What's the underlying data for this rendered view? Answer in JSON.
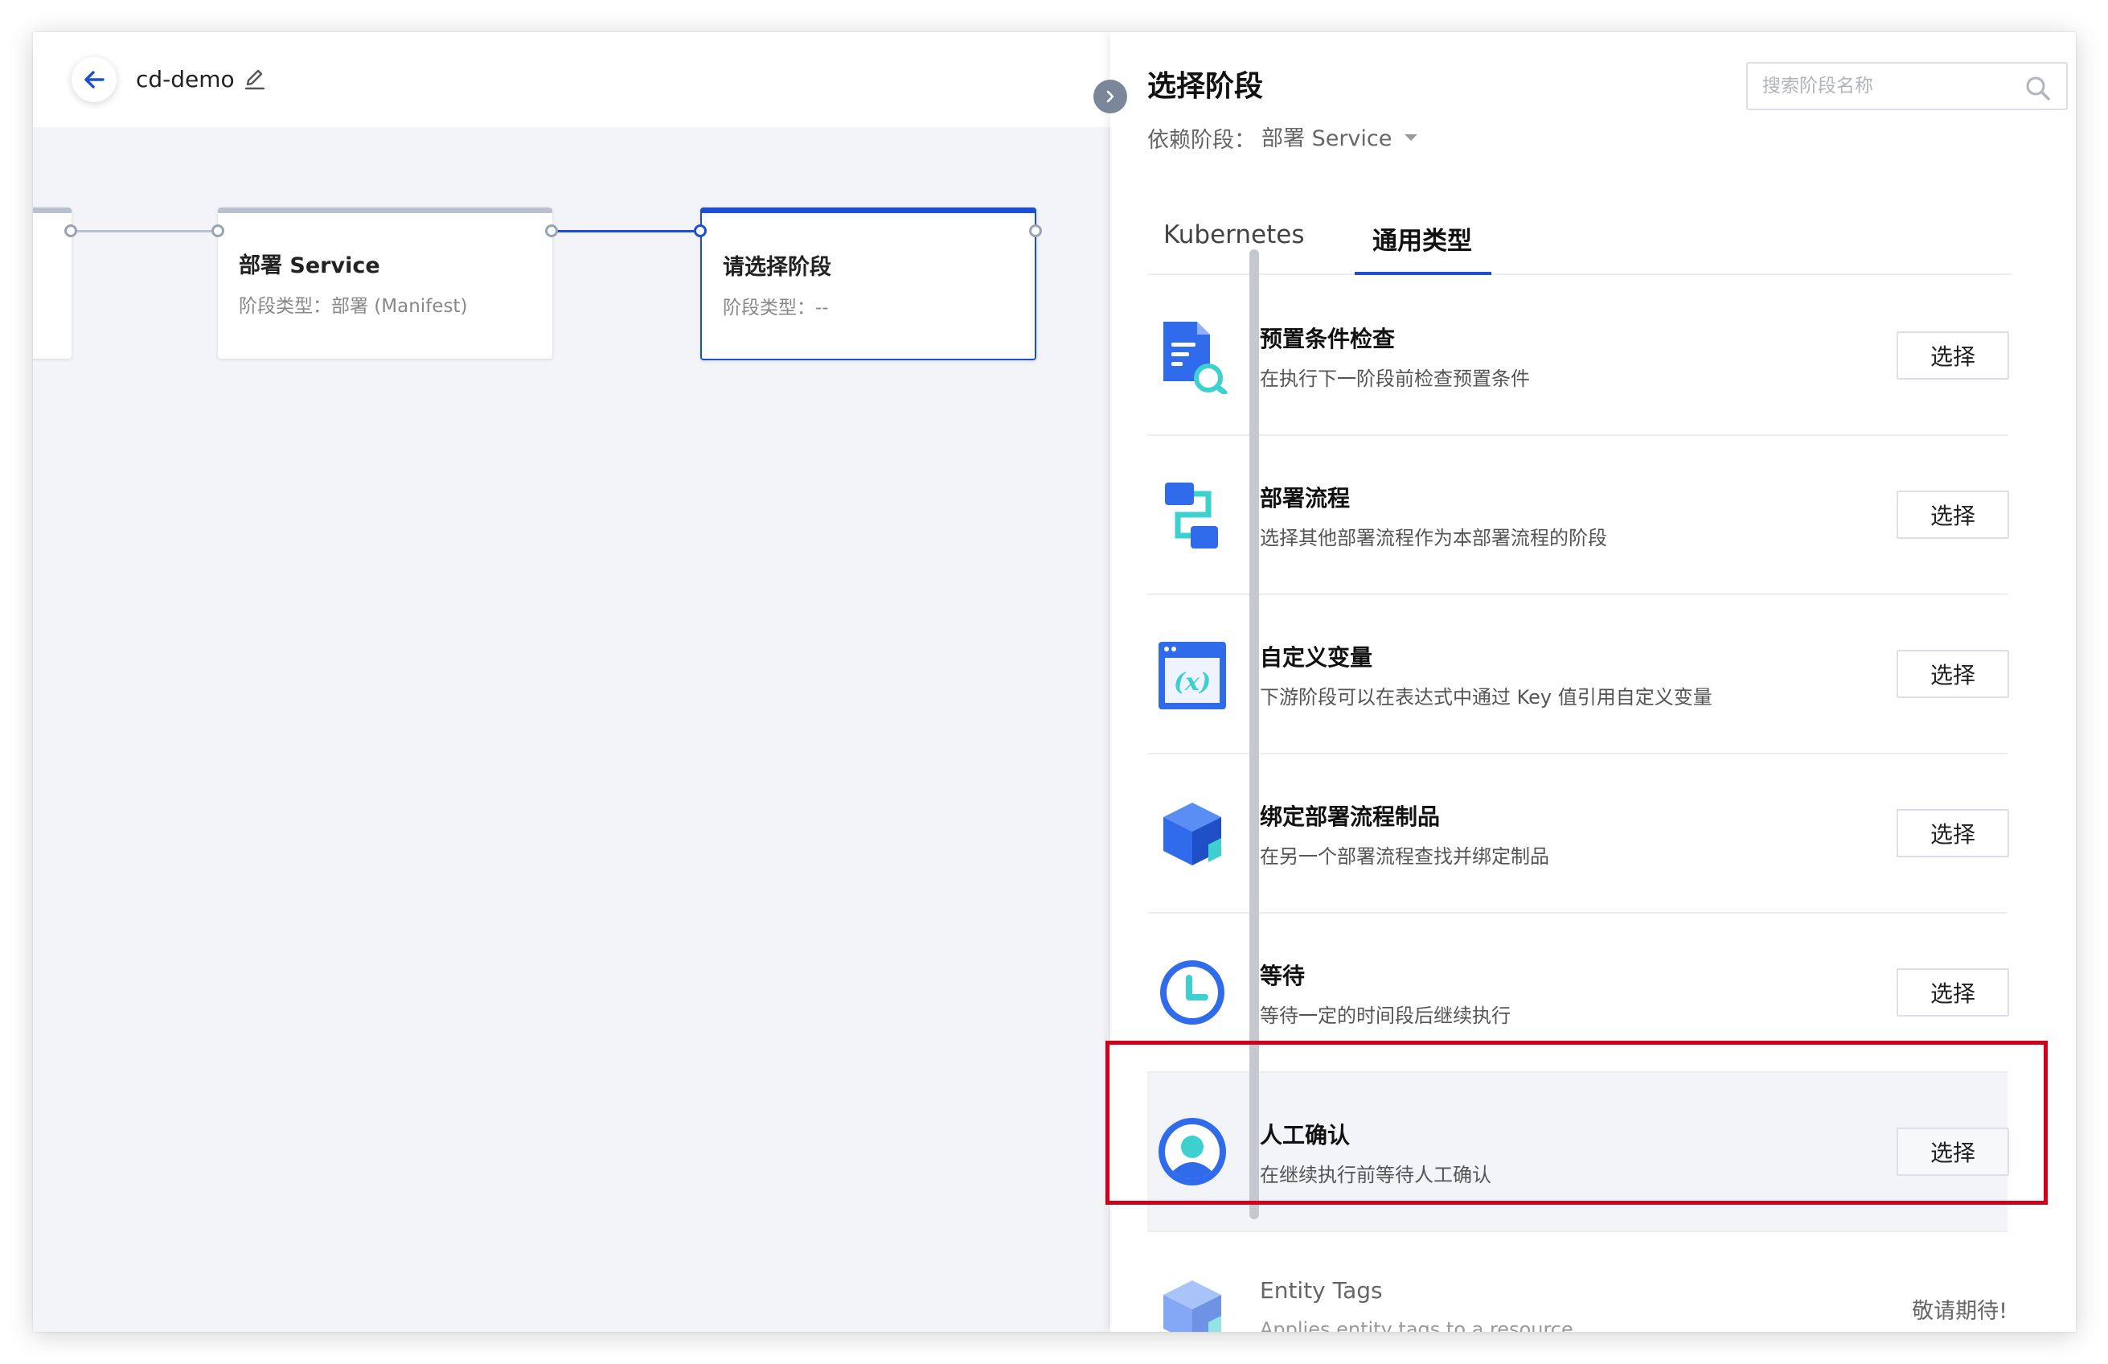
{
  "header": {
    "title": "cd-demo"
  },
  "canvas": {
    "nodes": [
      {
        "title": "部署 Service",
        "subtitle": "阶段类型：部署 (Manifest)"
      },
      {
        "title": "请选择阶段",
        "subtitle": "阶段类型：--"
      }
    ]
  },
  "panel": {
    "title": "选择阶段",
    "search_placeholder": "搜索阶段名称",
    "dependency_label": "依赖阶段：",
    "dependency_value": "部署 Service",
    "tabs": [
      {
        "label": "Kubernetes",
        "active": false
      },
      {
        "label": "通用类型",
        "active": true
      }
    ],
    "select_label": "选择",
    "items": [
      {
        "name": "预置条件检查",
        "desc": "在执行下一阶段前检查预置条件",
        "icon": "checklist-search-icon"
      },
      {
        "name": "部署流程",
        "desc": "选择其他部署流程作为本部署流程的阶段",
        "icon": "flow-icon"
      },
      {
        "name": "自定义变量",
        "desc": "下游阶段可以在表达式中通过 Key 值引用自定义变量",
        "icon": "variable-icon"
      },
      {
        "name": "绑定部署流程制品",
        "desc": "在另一个部署流程查找并绑定制品",
        "icon": "cube-icon"
      },
      {
        "name": "等待",
        "desc": "等待一定的时间段后继续执行",
        "icon": "clock-icon"
      },
      {
        "name": "人工确认",
        "desc": "在继续执行前等待人工确认",
        "icon": "user-icon",
        "highlighted": true
      },
      {
        "name": "Entity Tags",
        "desc": "Applies entity tags to a resource.",
        "icon": "cube-icon",
        "coming_soon": "敬请期待!"
      }
    ]
  },
  "colors": {
    "accent": "#1a4fd6",
    "highlight_frame": "#d0021b",
    "canvas_bg": "#f2f4f8",
    "icon_blue": "#2f6bea",
    "icon_teal": "#3ecfcf"
  }
}
